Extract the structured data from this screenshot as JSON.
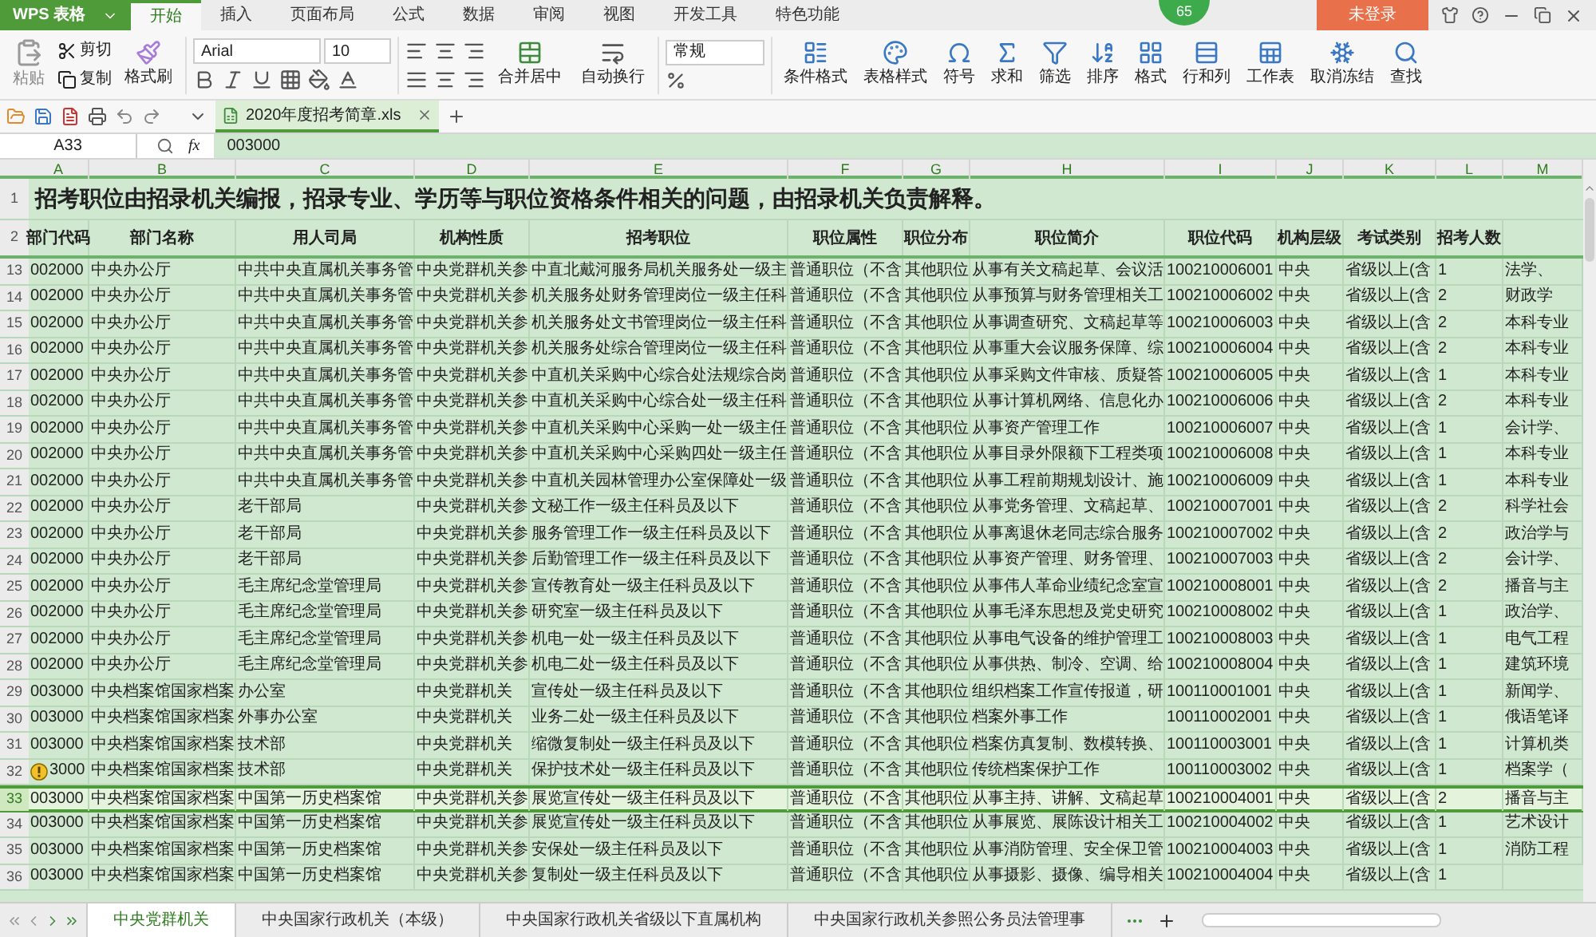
{
  "app": {
    "title": "WPS 表格"
  },
  "menu_tabs": [
    {
      "label": "开始",
      "selected": true
    },
    {
      "label": "插入",
      "selected": false
    },
    {
      "label": "页面布局",
      "selected": false
    },
    {
      "label": "公式",
      "selected": false
    },
    {
      "label": "数据",
      "selected": false
    },
    {
      "label": "审阅",
      "selected": false
    },
    {
      "label": "视图",
      "selected": false
    },
    {
      "label": "开发工具",
      "selected": false
    },
    {
      "label": "特色功能",
      "selected": false
    }
  ],
  "level_badge": "65",
  "login_button": "未登录",
  "ribbon": {
    "paste": "粘贴",
    "cut": "剪切",
    "copy": "复制",
    "format_painter": "格式刷",
    "font_name": "Arial",
    "font_size": "10",
    "merge": "合并居中",
    "wrap": "自动换行",
    "number_format": "常规",
    "buttons": [
      {
        "label": "条件格式"
      },
      {
        "label": "表格样式"
      },
      {
        "label": "符号"
      },
      {
        "label": "求和"
      },
      {
        "label": "筛选"
      },
      {
        "label": "排序"
      },
      {
        "label": "格式"
      },
      {
        "label": "行和列"
      },
      {
        "label": "工作表"
      },
      {
        "label": "取消冻结"
      },
      {
        "label": "查找"
      }
    ]
  },
  "document_tab": {
    "title": "2020年度招考简章.xls",
    "selected": true
  },
  "formula_bar": {
    "cell": "A33",
    "fx": "fx",
    "formula": "003000"
  },
  "columns": [
    "A",
    "B",
    "C",
    "D",
    "E",
    "F",
    "G",
    "H",
    "I",
    "J",
    "K",
    "L",
    "M"
  ],
  "sheet": {
    "title_row": "1",
    "header_row": "2",
    "title": "招考职位由招录机关编报，招录专业、学历等与职位资格条件相关的问题，由招录机关负责解释。",
    "headers": [
      "部门代码",
      "部门名称",
      "用人司局",
      "机构性质",
      "招考职位",
      "职位属性",
      "职位分布",
      "职位简介",
      "职位代码",
      "机构层级",
      "考试类别",
      "招考人数"
    ],
    "rows": [
      {
        "number": "13",
        "selected": false,
        "warning": false,
        "cells": [
          "002000",
          "中央办公厅",
          "中共中央直属机关事务管",
          "中央党群机关参",
          "中直北戴河服务局机关服务处一级主",
          "普通职位（不含",
          "其他职位",
          "从事有关文稿起草、会议活",
          "100210006001",
          "中央",
          "省级以上(含",
          "1",
          "法学、"
        ]
      },
      {
        "number": "14",
        "selected": false,
        "warning": false,
        "cells": [
          "002000",
          "中央办公厅",
          "中共中央直属机关事务管",
          "中央党群机关参",
          "机关服务处财务管理岗位一级主任科",
          "普通职位（不含",
          "其他职位",
          "从事预算与财务管理相关工",
          "100210006002",
          "中央",
          "省级以上(含",
          "2",
          "财政学"
        ]
      },
      {
        "number": "15",
        "selected": false,
        "warning": false,
        "cells": [
          "002000",
          "中央办公厅",
          "中共中央直属机关事务管",
          "中央党群机关参",
          "机关服务处文书管理岗位一级主任科",
          "普通职位（不含",
          "其他职位",
          "从事调查研究、文稿起草等",
          "100210006003",
          "中央",
          "省级以上(含",
          "2",
          "本科专业"
        ]
      },
      {
        "number": "16",
        "selected": false,
        "warning": false,
        "cells": [
          "002000",
          "中央办公厅",
          "中共中央直属机关事务管",
          "中央党群机关参",
          "机关服务处综合管理岗位一级主任科",
          "普通职位（不含",
          "其他职位",
          "从事重大会议服务保障、综",
          "100210006004",
          "中央",
          "省级以上(含",
          "2",
          "本科专业"
        ]
      },
      {
        "number": "17",
        "selected": false,
        "warning": false,
        "cells": [
          "002000",
          "中央办公厅",
          "中共中央直属机关事务管",
          "中央党群机关参",
          "中直机关采购中心综合处法规综合岗",
          "普通职位（不含",
          "其他职位",
          "从事采购文件审核、质疑答",
          "100210006005",
          "中央",
          "省级以上(含",
          "1",
          "本科专业"
        ]
      },
      {
        "number": "18",
        "selected": false,
        "warning": false,
        "cells": [
          "002000",
          "中央办公厅",
          "中共中央直属机关事务管",
          "中央党群机关参",
          "中直机关采购中心综合处一级主任科",
          "普通职位（不含",
          "其他职位",
          "从事计算机网络、信息化办",
          "100210006006",
          "中央",
          "省级以上(含",
          "2",
          "本科专业"
        ]
      },
      {
        "number": "19",
        "selected": false,
        "warning": false,
        "cells": [
          "002000",
          "中央办公厅",
          "中共中央直属机关事务管",
          "中央党群机关参",
          "中直机关采购中心采购一处一级主任",
          "普通职位（不含",
          "其他职位",
          "从事资产管理工作",
          "100210006007",
          "中央",
          "省级以上(含",
          "1",
          "会计学、"
        ]
      },
      {
        "number": "20",
        "selected": false,
        "warning": false,
        "cells": [
          "002000",
          "中央办公厅",
          "中共中央直属机关事务管",
          "中央党群机关参",
          "中直机关采购中心采购四处一级主任",
          "普通职位（不含",
          "其他职位",
          "从事目录外限额下工程类项",
          "100210006008",
          "中央",
          "省级以上(含",
          "1",
          "本科专业"
        ]
      },
      {
        "number": "21",
        "selected": false,
        "warning": false,
        "cells": [
          "002000",
          "中央办公厅",
          "中共中央直属机关事务管",
          "中央党群机关参",
          "中直机关园林管理办公室保障处一级",
          "普通职位（不含",
          "其他职位",
          "从事工程前期规划设计、施",
          "100210006009",
          "中央",
          "省级以上(含",
          "1",
          "本科专业"
        ]
      },
      {
        "number": "22",
        "selected": false,
        "warning": false,
        "cells": [
          "002000",
          "中央办公厅",
          "老干部局",
          "中央党群机关参",
          "文秘工作一级主任科员及以下",
          "普通职位（不含",
          "其他职位",
          "从事党务管理、文稿起草、",
          "100210007001",
          "中央",
          "省级以上(含",
          "2",
          "科学社会"
        ]
      },
      {
        "number": "23",
        "selected": false,
        "warning": false,
        "cells": [
          "002000",
          "中央办公厅",
          "老干部局",
          "中央党群机关参",
          "服务管理工作一级主任科员及以下",
          "普通职位（不含",
          "其他职位",
          "从事离退休老同志综合服务",
          "100210007002",
          "中央",
          "省级以上(含",
          "2",
          "政治学与"
        ]
      },
      {
        "number": "24",
        "selected": false,
        "warning": false,
        "cells": [
          "002000",
          "中央办公厅",
          "老干部局",
          "中央党群机关参",
          "后勤管理工作一级主任科员及以下",
          "普通职位（不含",
          "其他职位",
          "从事资产管理、财务管理、",
          "100210007003",
          "中央",
          "省级以上(含",
          "2",
          "会计学、"
        ]
      },
      {
        "number": "25",
        "selected": false,
        "warning": false,
        "cells": [
          "002000",
          "中央办公厅",
          "毛主席纪念堂管理局",
          "中央党群机关参",
          "宣传教育处一级主任科员及以下",
          "普通职位（不含",
          "其他职位",
          "从事伟人革命业绩纪念室宣",
          "100210008001",
          "中央",
          "省级以上(含",
          "2",
          "播音与主"
        ]
      },
      {
        "number": "26",
        "selected": false,
        "warning": false,
        "cells": [
          "002000",
          "中央办公厅",
          "毛主席纪念堂管理局",
          "中央党群机关参",
          "研究室一级主任科员及以下",
          "普通职位（不含",
          "其他职位",
          "从事毛泽东思想及党史研究",
          "100210008002",
          "中央",
          "省级以上(含",
          "1",
          "政治学、"
        ]
      },
      {
        "number": "27",
        "selected": false,
        "warning": false,
        "cells": [
          "002000",
          "中央办公厅",
          "毛主席纪念堂管理局",
          "中央党群机关参",
          "机电一处一级主任科员及以下",
          "普通职位（不含",
          "其他职位",
          "从事电气设备的维护管理工",
          "100210008003",
          "中央",
          "省级以上(含",
          "1",
          "电气工程"
        ]
      },
      {
        "number": "28",
        "selected": false,
        "warning": false,
        "cells": [
          "002000",
          "中央办公厅",
          "毛主席纪念堂管理局",
          "中央党群机关参",
          "机电二处一级主任科员及以下",
          "普通职位（不含",
          "其他职位",
          "从事供热、制冷、空调、给",
          "100210008004",
          "中央",
          "省级以上(含",
          "1",
          "建筑环境"
        ]
      },
      {
        "number": "29",
        "selected": false,
        "warning": false,
        "cells": [
          "003000",
          "中央档案馆国家档案",
          "办公室",
          "中央党群机关",
          "宣传处一级主任科员及以下",
          "普通职位（不含",
          "其他职位",
          "组织档案工作宣传报道，研",
          "100110001001",
          "中央",
          "省级以上(含",
          "1",
          "新闻学、"
        ]
      },
      {
        "number": "30",
        "selected": false,
        "warning": false,
        "cells": [
          "003000",
          "中央档案馆国家档案",
          "外事办公室",
          "中央党群机关",
          "业务二处一级主任科员及以下",
          "普通职位（不含",
          "其他职位",
          "档案外事工作",
          "100110002001",
          "中央",
          "省级以上(含",
          "1",
          "俄语笔译"
        ]
      },
      {
        "number": "31",
        "selected": false,
        "warning": false,
        "cells": [
          "003000",
          "中央档案馆国家档案",
          "技术部",
          "中央党群机关",
          "缩微复制处一级主任科员及以下",
          "普通职位（不含",
          "其他职位",
          "档案仿真复制、数模转换、",
          "100110003001",
          "中央",
          "省级以上(含",
          "1",
          "计算机类"
        ]
      },
      {
        "number": "32",
        "selected": false,
        "warning": true,
        "cells": [
          "3000",
          "中央档案馆国家档案",
          "技术部",
          "中央党群机关",
          "保护技术处一级主任科员及以下",
          "普通职位（不含",
          "其他职位",
          "传统档案保护工作",
          "100110003002",
          "中央",
          "省级以上(含",
          "1",
          "档案学（"
        ]
      },
      {
        "number": "33",
        "selected": true,
        "warning": false,
        "cells": [
          "003000",
          "中央档案馆国家档案",
          "中国第一历史档案馆",
          "中央党群机关参",
          "展览宣传处一级主任科员及以下",
          "普通职位（不含",
          "其他职位",
          "从事主持、讲解、文稿起草",
          "100210004001",
          "中央",
          "省级以上(含",
          "2",
          "播音与主"
        ]
      },
      {
        "number": "34",
        "selected": false,
        "warning": false,
        "cells": [
          "003000",
          "中央档案馆国家档案",
          "中国第一历史档案馆",
          "中央党群机关参",
          "展览宣传处一级主任科员及以下",
          "普通职位（不含",
          "其他职位",
          "从事展览、展陈设计相关工",
          "100210004002",
          "中央",
          "省级以上(含",
          "1",
          "艺术设计"
        ]
      },
      {
        "number": "35",
        "selected": false,
        "warning": false,
        "cells": [
          "003000",
          "中央档案馆国家档案",
          "中国第一历史档案馆",
          "中央党群机关参",
          "安保处一级主任科员及以下",
          "普通职位（不含",
          "其他职位",
          "从事消防管理、安全保卫管",
          "100210004003",
          "中央",
          "省级以上(含",
          "1",
          "消防工程"
        ]
      },
      {
        "number": "36",
        "selected": false,
        "warning": false,
        "cells": [
          "003000",
          "中央档案馆国家档案",
          "中国第一历史档案馆",
          "中央党群机关参",
          "复制处一级主任科员及以下",
          "普通职位（不含",
          "其他职位",
          "从事摄影、摄像、编导相关",
          "100210004004",
          "中央",
          "省级以上(含",
          "1"
        ]
      }
    ]
  },
  "sheet_tabs": [
    {
      "label": "中央党群机关",
      "selected": true
    },
    {
      "label": "中央国家行政机关（本级）",
      "selected": false
    },
    {
      "label": "中央国家行政机关省级以下直属机构",
      "selected": false
    },
    {
      "label": "中央国家行政机关参照公务员法管理事",
      "selected": false
    }
  ]
}
